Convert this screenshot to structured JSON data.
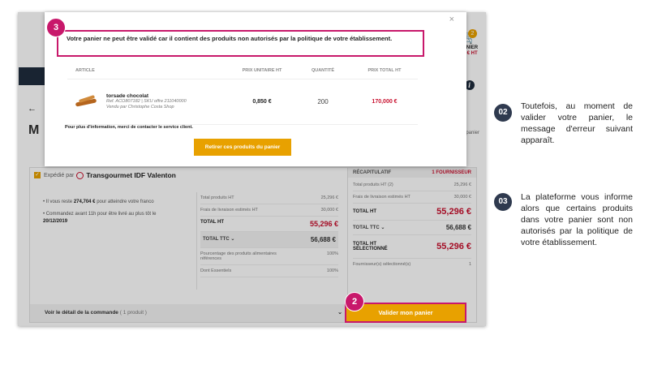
{
  "cart": {
    "badge_count": "2",
    "label": "PANIER",
    "price": "56 € HT",
    "info_label": "er",
    "partial_link": "de panier"
  },
  "supplier": {
    "shipped_by": "Expédié par",
    "name": "Transgourmet IDF Valenton",
    "bullet1_prefix": "Il vous reste",
    "bullet1_amount": "274,704 €",
    "bullet1_suffix": "pour atteindre votre franco",
    "bullet2_prefix": "Commandez avant 11h pour être livré au plus tôt le",
    "bullet2_date": "20/12/2019",
    "totals": [
      {
        "label": "Total produits HT",
        "value": "25,296 €"
      },
      {
        "label": "Frais de livraison estimés HT",
        "value": "30,000 €"
      }
    ],
    "total_ht_label": "TOTAL HT",
    "total_ht_value": "55,296 €",
    "total_ttc_label": "TOTAL TTC",
    "total_ttc_value": "56,688 €",
    "food_pct_label": "Pourcentage des produits alimentaires références",
    "food_pct_value": "100%",
    "essentials_label": "Dont Essentiels",
    "essentials_value": "100%",
    "detail_label": "Voir le détail de la commande",
    "detail_count": "( 1 produit )"
  },
  "summary": {
    "title": "RÉCAPITULATIF",
    "suppliers": "1 FOURNISSEUR",
    "products_label": "Total produits HT (2)",
    "products_value": "25,296 €",
    "delivery_label": "Frais de livraison estimés HT",
    "delivery_value": "30,000 €",
    "total_ht_label": "TOTAL HT",
    "total_ht_value": "55,296 €",
    "total_ttc_label": "TOTAL TTC",
    "total_ttc_value": "56,688 €",
    "selected_label": "TOTAL HT SÉLECTIONNÉ",
    "selected_value": "55,296 €",
    "selected_count_label": "Fournisseur(s) sélectionné(s)",
    "selected_count_value": "1",
    "validate_button": "Valider mon panier"
  },
  "modal": {
    "close": "×",
    "error_message": "Votre panier ne peut être validé car il contient des produits non autorisés par la politique de votre établissement.",
    "columns": [
      "ARTICLE",
      "PRIX UNITAIRE HT",
      "QUANTITÉ",
      "PRIX TOTAL HT"
    ],
    "product": {
      "name": "torsade chocolat",
      "ref": "Ref. ACO807182 | SKU offre 211040000",
      "seller": "Vendu par Christophe Costa Shop",
      "unit_price": "0,850 €",
      "quantity": "200",
      "total_price": "170,000 €"
    },
    "contact_text": "Pour plus d'information, merci de contacter le service client.",
    "remove_button": "Retirer ces produits du panier"
  },
  "step_badges": {
    "modal_badge": "3",
    "validate_badge": "2"
  },
  "notes": [
    {
      "number": "02",
      "text": "Toutefois, au moment de valider votre panier, le message d'erreur suivant apparaît."
    },
    {
      "number": "03",
      "text": "La plateforme vous informe alors que certains produits dans votre panier sont non autorisés par la politique de votre établissement."
    }
  ],
  "colors": {
    "accent": "#e8a100",
    "highlight": "#c8186b",
    "price_red": "#c8102e",
    "navy": "#2f3a4f"
  }
}
